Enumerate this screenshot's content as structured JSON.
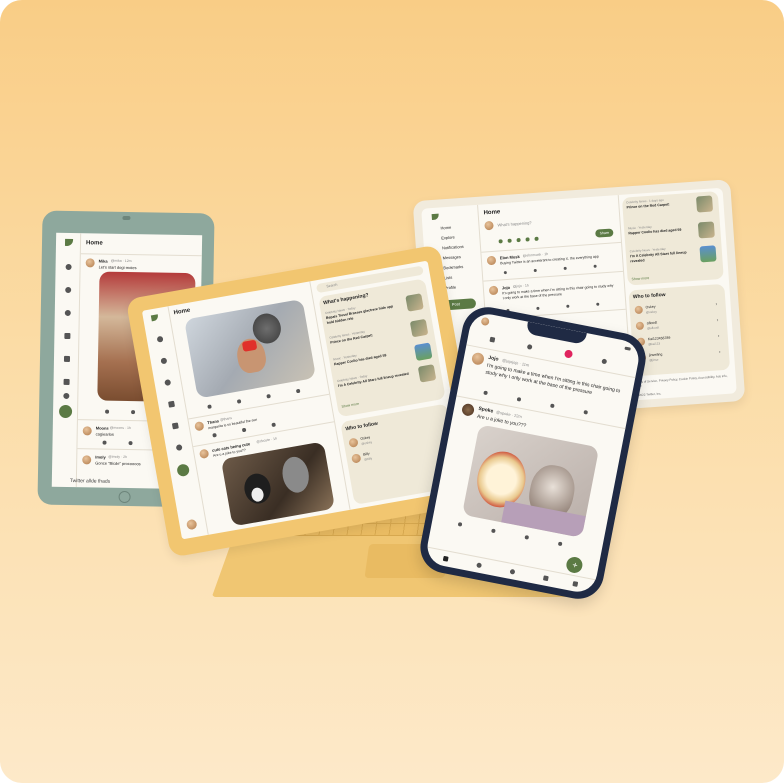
{
  "colors": {
    "accent": "#5b7a44",
    "cream": "#f6f3ea",
    "panel": "#efe9d8",
    "like": "#e0245e"
  },
  "tablet": {
    "tab": "Home",
    "tweets": [
      {
        "name": "Mika",
        "handle": "@mika · 12m",
        "text": "Let's start dogi·moies"
      },
      {
        "name": "Moons",
        "handle": "@moons · 1h",
        "text": "cagiearlos"
      },
      {
        "name": "Imoly",
        "handle": "@imoly · 2h",
        "text": "Gonce \"Bicde\" procoooos"
      }
    ],
    "footer": "Twitter allde thads"
  },
  "laptop": {
    "tab": "Home",
    "search": "Search",
    "trends_title": "What's happening?",
    "trends": [
      {
        "meta": "Celebrity News · Today",
        "text": "Bepais Tiesel Brasses glectrere hide upp hold hidden rele"
      },
      {
        "meta": "Celebrity News · Yesterday",
        "text": "Prince on the Red Carpet!"
      },
      {
        "meta": "Music · Yesterday",
        "text": "Rapper Coolio has died aged 59"
      },
      {
        "meta": "Celebrity News · Today",
        "text": "I'm A Celebrity All Stars full lineup revealed"
      }
    ],
    "show_more": "Show more",
    "who_title": "Who to follow",
    "who": [
      {
        "name": "Oskey",
        "handle": "@oskey"
      },
      {
        "name": "Billy",
        "handle": "@billy"
      }
    ],
    "tweets": [
      {
        "name": "Thans",
        "handle": "@thans",
        "text": "margarita is so beautiful the sun"
      },
      {
        "name": "cute cats being cute",
        "handle": "@cbcute · 1h",
        "text": "Are u a joke to you??"
      }
    ]
  },
  "desktop": {
    "tab": "Home",
    "compose_placeholder": "What's happening?",
    "tweet_button": "Share",
    "nav": [
      "Home",
      "Explore",
      "Notifications",
      "Messages",
      "Bookmarks",
      "Lists",
      "Profile"
    ],
    "nav_button": "Post",
    "tweets": [
      {
        "name": "Elon Musk",
        "handle": "@elonmusk · 1h",
        "text": "Buying Twitter is an accelerant to creating X, the everything app"
      },
      {
        "name": "Jojo",
        "handle": "@jojo · 1h",
        "text": "It's going to make a time when I'm sitting in this chair going to study why I only work at the base of the pressure"
      },
      {
        "name": "Spoke",
        "handle": "@spoke · 2h",
        "text": ""
      }
    ],
    "trends": [
      {
        "meta": "Celebrity News · 1 days ago",
        "text": "Prince on the Red Carpet!"
      },
      {
        "meta": "Music · Yesterday",
        "text": "Rapper Coolio has died aged 59"
      },
      {
        "meta": "Celebrity News · Yesterday",
        "text": "I'm A Celebrity All Stars full lineup revealed"
      }
    ],
    "show_more": "Show more",
    "who_title": "Who to follow",
    "who": [
      {
        "name": "Oskey",
        "handle": "@oskey"
      },
      {
        "name": "afloodt",
        "handle": "@afloodt"
      },
      {
        "name": "Kai123456789",
        "handle": "@kai123"
      },
      {
        "name": "jinseiling",
        "handle": "@jinse"
      }
    ],
    "footer": "Terms of Service, Privacy Policy, Cookie Policy, Accessibility, Ads info, More",
    "copyright": "© 2022 Twitter, Inc."
  },
  "phone": {
    "tweets": [
      {
        "name": "Jojo",
        "handle": "@jojojojo · 11m",
        "text": "I'm going to make a time when I'm sitting in this chair going to study why I only work at the base of the pressure"
      },
      {
        "name": "Spoke",
        "handle": "@spoke · 22m",
        "text": "Are u a joke to you???"
      }
    ]
  }
}
